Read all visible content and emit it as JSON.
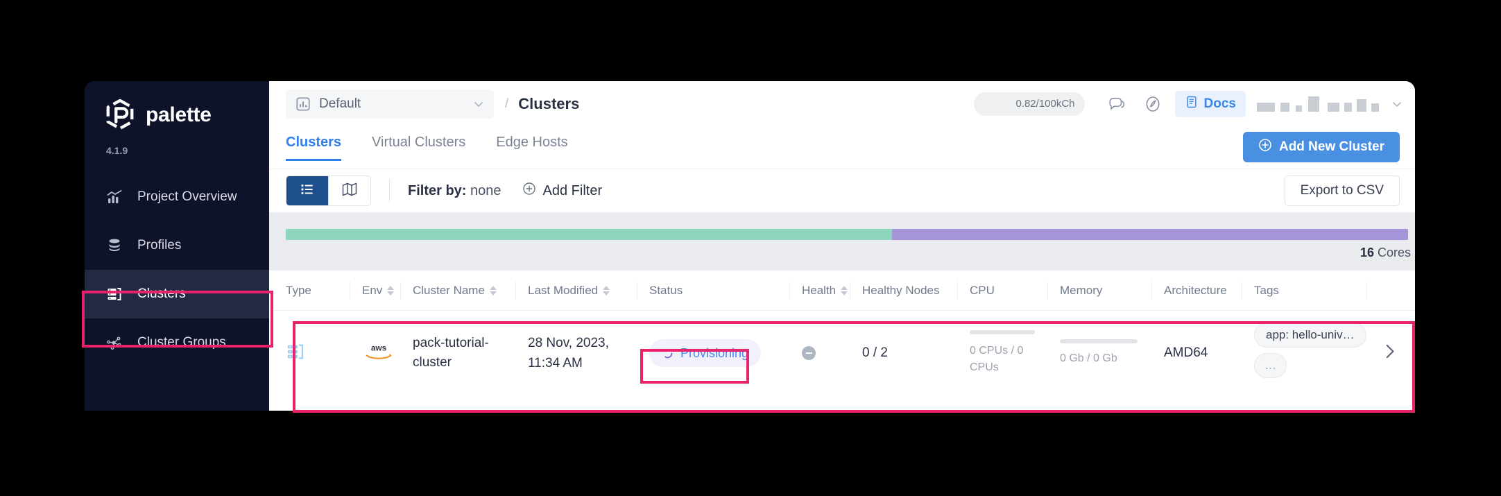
{
  "sidebar": {
    "logo_text": "palette",
    "version": "4.1.9",
    "items": [
      {
        "label": "Project Overview",
        "icon": "chart-bars-icon",
        "active": false
      },
      {
        "label": "Profiles",
        "icon": "database-stack-icon",
        "active": false
      },
      {
        "label": "Clusters",
        "icon": "cluster-list-icon",
        "active": true
      },
      {
        "label": "Cluster Groups",
        "icon": "nodes-graph-icon",
        "active": false
      }
    ]
  },
  "header": {
    "project_name": "Default",
    "project_icon": "chart-square-icon",
    "breadcrumb_separator": "/",
    "breadcrumb_current": "Clusters",
    "credits": "0.82/100kCh",
    "chat_icon": "chat-bubbles-icon",
    "compass_icon": "compass-icon",
    "docs_label": "Docs",
    "docs_icon": "book-icon",
    "user_chevron_icon": "chevron-down-icon"
  },
  "tabs": [
    {
      "label": "Clusters",
      "active": true
    },
    {
      "label": "Virtual Clusters",
      "active": false
    },
    {
      "label": "Edge Hosts",
      "active": false
    }
  ],
  "actions": {
    "add_cluster_label": "Add New Cluster",
    "add_cluster_icon": "plus-circle-icon",
    "export_label": "Export to CSV",
    "list_view_icon": "list-view-icon",
    "map_view_icon": "map-view-icon"
  },
  "filters": {
    "filter_by_label": "Filter by:",
    "filter_by_value": "none",
    "add_filter_label": "Add Filter",
    "add_filter_icon": "plus-circle-icon"
  },
  "cores": {
    "label_value": "16",
    "label_unit": "Cores",
    "segments": [
      {
        "name": "used-green",
        "percent": 54,
        "color": "#8ed6bb"
      },
      {
        "name": "used-purple",
        "percent": 46,
        "color": "#a694d9"
      }
    ]
  },
  "table": {
    "columns": [
      {
        "label": "Type",
        "sortable": false
      },
      {
        "label": "Env",
        "sortable": true
      },
      {
        "label": "Cluster Name",
        "sortable": true
      },
      {
        "label": "Last Modified",
        "sortable": true
      },
      {
        "label": "Status",
        "sortable": false
      },
      {
        "label": "Health",
        "sortable": true
      },
      {
        "label": "Healthy Nodes",
        "sortable": false
      },
      {
        "label": "CPU",
        "sortable": false
      },
      {
        "label": "Memory",
        "sortable": false
      },
      {
        "label": "Architecture",
        "sortable": false
      },
      {
        "label": "Tags",
        "sortable": false
      }
    ],
    "rows": [
      {
        "type_icon": "cluster-list-icon",
        "env": "aws",
        "cluster_name": "pack-tutorial-cluster",
        "last_modified": "28 Nov, 2023, 11:34 AM",
        "status": "Provisioning",
        "status_icon": "spinner-icon",
        "health_icon": "health-neutral-icon",
        "healthy_nodes": "0 / 2",
        "cpu": "0 CPUs / 0 CPUs",
        "memory": "0 Gb / 0 Gb",
        "architecture": "AMD64",
        "tags": [
          "app: hello-univ…",
          "…"
        ],
        "row_chevron_icon": "chevron-right-icon"
      }
    ]
  },
  "annotations": {
    "accent": "#e8236b",
    "boxes": [
      "sidebar-clusters",
      "cluster-table-row",
      "status-provisioning"
    ]
  }
}
